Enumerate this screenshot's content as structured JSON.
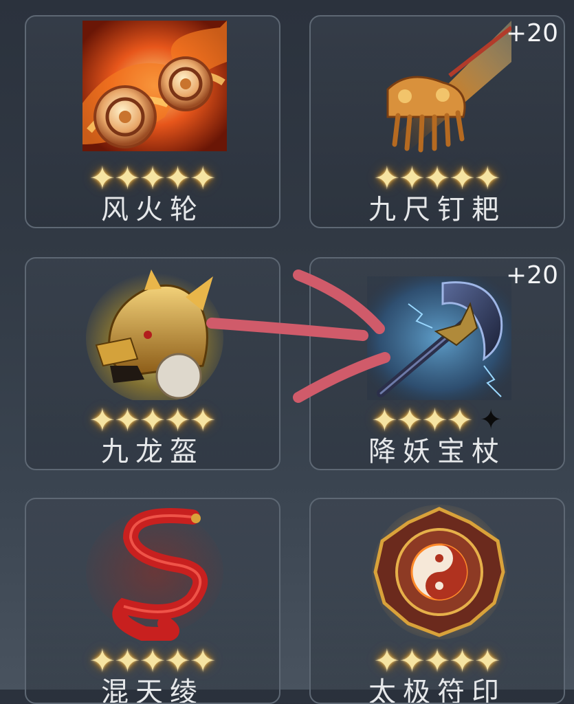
{
  "items": [
    {
      "name": "风火轮",
      "stars": 5,
      "level": "",
      "icon": "fire-wheels-icon"
    },
    {
      "name": "九尺钉耙",
      "stars": 5,
      "level": "+20",
      "icon": "nine-tooth-rake-icon"
    },
    {
      "name": "九龙盔",
      "stars": 5,
      "level": "",
      "icon": "dragon-helmet-icon"
    },
    {
      "name": "降妖宝杖",
      "stars": 4,
      "level": "+20",
      "icon": "demon-subduing-staff-icon"
    },
    {
      "name": "混天绫",
      "stars": 5,
      "level": "",
      "icon": "red-silk-sash-icon"
    },
    {
      "name": "太极符印",
      "stars": 5,
      "level": "",
      "icon": "taiji-seal-icon"
    }
  ],
  "star_glyph": "✦",
  "colors": {
    "star": "#f6e4a2",
    "annotation": "#d05b6a"
  }
}
